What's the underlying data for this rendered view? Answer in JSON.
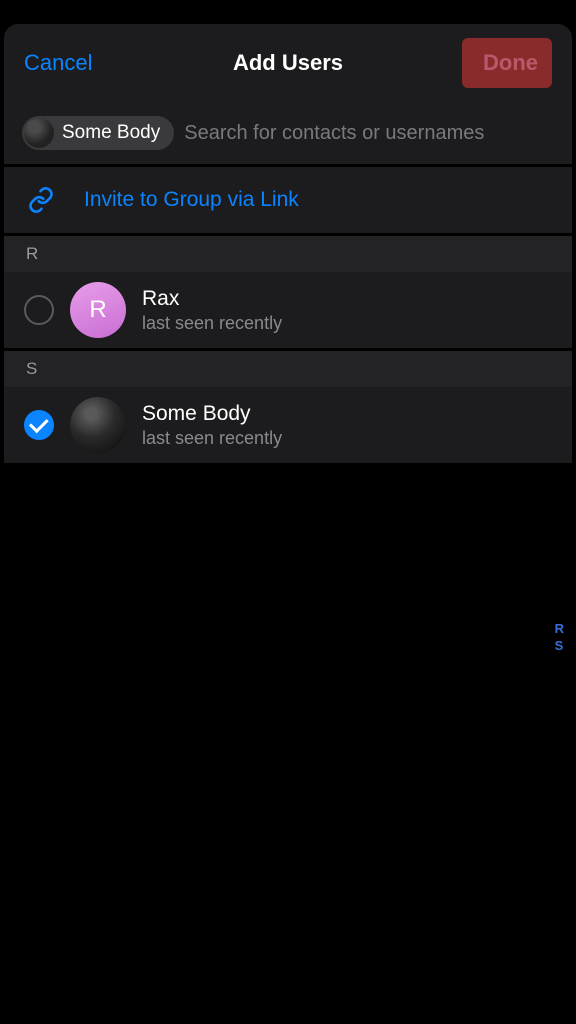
{
  "header": {
    "cancel": "Cancel",
    "title": "Add Users",
    "done": "Done"
  },
  "search": {
    "chip_label": "Some Body",
    "placeholder": "Search for contacts or usernames"
  },
  "invite": {
    "label": "Invite to Group via Link"
  },
  "sections": [
    {
      "letter": "R",
      "contacts": [
        {
          "name": "Rax",
          "status": "last seen recently",
          "avatar_letter": "R",
          "selected": false
        }
      ]
    },
    {
      "letter": "S",
      "contacts": [
        {
          "name": "Some Body",
          "status": "last seen recently",
          "selected": true
        }
      ]
    }
  ],
  "index_letters": [
    "R",
    "S"
  ]
}
